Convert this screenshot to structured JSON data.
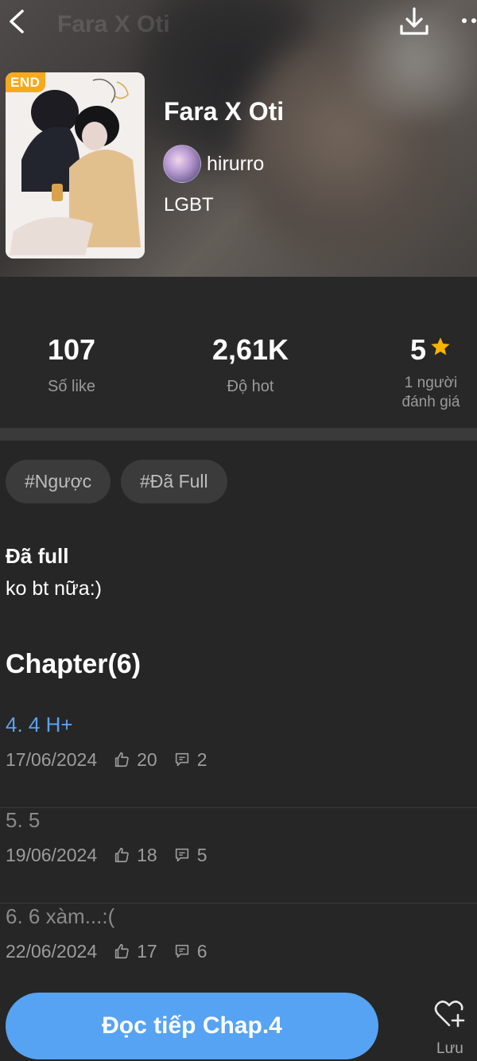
{
  "header": {
    "ghost_title": "Fara X Oti"
  },
  "story": {
    "badge": "END",
    "title": "Fara X Oti",
    "author": "hirurro",
    "category": "LGBT"
  },
  "stats": {
    "likes_value": "107",
    "likes_label": "Số like",
    "hot_value": "2,61K",
    "hot_label": "Độ hot",
    "rating_value": "5",
    "rating_label_line1": "1 người",
    "rating_label_line2": "đánh giá",
    "star_color": "#f7b500"
  },
  "tags": [
    "#Ngược",
    "#Đã Full"
  ],
  "description": {
    "title": "Đã full",
    "body": "ko bt nữa:)"
  },
  "chapters_heading": "Chapter(6)",
  "chapters": [
    {
      "title": "4. 4 H+",
      "date": "17/06/2024",
      "likes": "20",
      "comments": "2",
      "current": true
    },
    {
      "title": "5. 5",
      "date": "19/06/2024",
      "likes": "18",
      "comments": "5",
      "current": false
    },
    {
      "title": "6. 6 xàm...:(",
      "date": "22/06/2024",
      "likes": "17",
      "comments": "6",
      "current": false
    }
  ],
  "bottom_bar": {
    "read_button": "Đọc tiếp Chap.4",
    "save_label": "Lưu"
  },
  "colors": {
    "accent": "#56a3f3",
    "badge": "#f7a91e",
    "background": "#262626"
  },
  "icons": [
    "back-icon",
    "download-icon",
    "more-icon",
    "star-icon",
    "thumb-up-icon",
    "comment-icon",
    "heart-plus-icon"
  ]
}
